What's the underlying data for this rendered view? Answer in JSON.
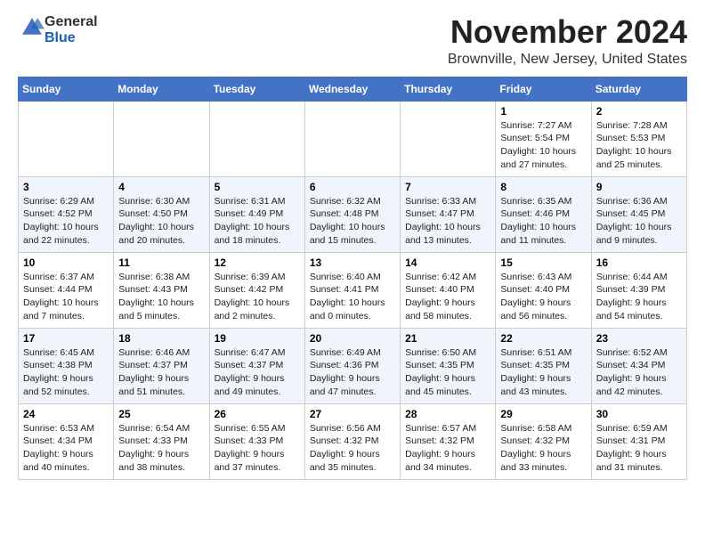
{
  "header": {
    "logo_general": "General",
    "logo_blue": "Blue",
    "month_title": "November 2024",
    "location": "Brownville, New Jersey, United States"
  },
  "days_of_week": [
    "Sunday",
    "Monday",
    "Tuesday",
    "Wednesday",
    "Thursday",
    "Friday",
    "Saturday"
  ],
  "weeks": [
    [
      {
        "day": "",
        "info": ""
      },
      {
        "day": "",
        "info": ""
      },
      {
        "day": "",
        "info": ""
      },
      {
        "day": "",
        "info": ""
      },
      {
        "day": "",
        "info": ""
      },
      {
        "day": "1",
        "info": "Sunrise: 7:27 AM\nSunset: 5:54 PM\nDaylight: 10 hours and 27 minutes."
      },
      {
        "day": "2",
        "info": "Sunrise: 7:28 AM\nSunset: 5:53 PM\nDaylight: 10 hours and 25 minutes."
      }
    ],
    [
      {
        "day": "3",
        "info": "Sunrise: 6:29 AM\nSunset: 4:52 PM\nDaylight: 10 hours and 22 minutes."
      },
      {
        "day": "4",
        "info": "Sunrise: 6:30 AM\nSunset: 4:50 PM\nDaylight: 10 hours and 20 minutes."
      },
      {
        "day": "5",
        "info": "Sunrise: 6:31 AM\nSunset: 4:49 PM\nDaylight: 10 hours and 18 minutes."
      },
      {
        "day": "6",
        "info": "Sunrise: 6:32 AM\nSunset: 4:48 PM\nDaylight: 10 hours and 15 minutes."
      },
      {
        "day": "7",
        "info": "Sunrise: 6:33 AM\nSunset: 4:47 PM\nDaylight: 10 hours and 13 minutes."
      },
      {
        "day": "8",
        "info": "Sunrise: 6:35 AM\nSunset: 4:46 PM\nDaylight: 10 hours and 11 minutes."
      },
      {
        "day": "9",
        "info": "Sunrise: 6:36 AM\nSunset: 4:45 PM\nDaylight: 10 hours and 9 minutes."
      }
    ],
    [
      {
        "day": "10",
        "info": "Sunrise: 6:37 AM\nSunset: 4:44 PM\nDaylight: 10 hours and 7 minutes."
      },
      {
        "day": "11",
        "info": "Sunrise: 6:38 AM\nSunset: 4:43 PM\nDaylight: 10 hours and 5 minutes."
      },
      {
        "day": "12",
        "info": "Sunrise: 6:39 AM\nSunset: 4:42 PM\nDaylight: 10 hours and 2 minutes."
      },
      {
        "day": "13",
        "info": "Sunrise: 6:40 AM\nSunset: 4:41 PM\nDaylight: 10 hours and 0 minutes."
      },
      {
        "day": "14",
        "info": "Sunrise: 6:42 AM\nSunset: 4:40 PM\nDaylight: 9 hours and 58 minutes."
      },
      {
        "day": "15",
        "info": "Sunrise: 6:43 AM\nSunset: 4:40 PM\nDaylight: 9 hours and 56 minutes."
      },
      {
        "day": "16",
        "info": "Sunrise: 6:44 AM\nSunset: 4:39 PM\nDaylight: 9 hours and 54 minutes."
      }
    ],
    [
      {
        "day": "17",
        "info": "Sunrise: 6:45 AM\nSunset: 4:38 PM\nDaylight: 9 hours and 52 minutes."
      },
      {
        "day": "18",
        "info": "Sunrise: 6:46 AM\nSunset: 4:37 PM\nDaylight: 9 hours and 51 minutes."
      },
      {
        "day": "19",
        "info": "Sunrise: 6:47 AM\nSunset: 4:37 PM\nDaylight: 9 hours and 49 minutes."
      },
      {
        "day": "20",
        "info": "Sunrise: 6:49 AM\nSunset: 4:36 PM\nDaylight: 9 hours and 47 minutes."
      },
      {
        "day": "21",
        "info": "Sunrise: 6:50 AM\nSunset: 4:35 PM\nDaylight: 9 hours and 45 minutes."
      },
      {
        "day": "22",
        "info": "Sunrise: 6:51 AM\nSunset: 4:35 PM\nDaylight: 9 hours and 43 minutes."
      },
      {
        "day": "23",
        "info": "Sunrise: 6:52 AM\nSunset: 4:34 PM\nDaylight: 9 hours and 42 minutes."
      }
    ],
    [
      {
        "day": "24",
        "info": "Sunrise: 6:53 AM\nSunset: 4:34 PM\nDaylight: 9 hours and 40 minutes."
      },
      {
        "day": "25",
        "info": "Sunrise: 6:54 AM\nSunset: 4:33 PM\nDaylight: 9 hours and 38 minutes."
      },
      {
        "day": "26",
        "info": "Sunrise: 6:55 AM\nSunset: 4:33 PM\nDaylight: 9 hours and 37 minutes."
      },
      {
        "day": "27",
        "info": "Sunrise: 6:56 AM\nSunset: 4:32 PM\nDaylight: 9 hours and 35 minutes."
      },
      {
        "day": "28",
        "info": "Sunrise: 6:57 AM\nSunset: 4:32 PM\nDaylight: 9 hours and 34 minutes."
      },
      {
        "day": "29",
        "info": "Sunrise: 6:58 AM\nSunset: 4:32 PM\nDaylight: 9 hours and 33 minutes."
      },
      {
        "day": "30",
        "info": "Sunrise: 6:59 AM\nSunset: 4:31 PM\nDaylight: 9 hours and 31 minutes."
      }
    ]
  ]
}
